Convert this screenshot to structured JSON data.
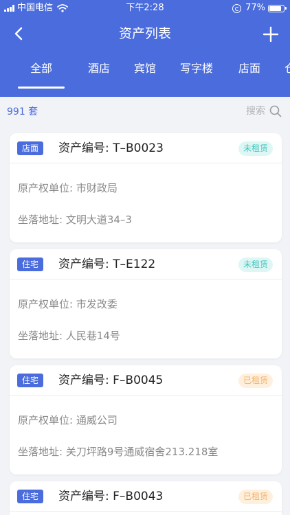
{
  "status_bar": {
    "carrier": "中国电信",
    "time": "下午2:28",
    "battery": "77%"
  },
  "nav": {
    "title": "资产列表"
  },
  "tabs": [
    "全部",
    "酒店",
    "宾馆",
    "写字楼",
    "店面",
    "仓"
  ],
  "active_tab_index": 0,
  "summary": {
    "count": "991 套",
    "search_label": "搜索"
  },
  "assets": [
    {
      "type": "店面",
      "code": "资产编号: T–B0023",
      "status": "未租赁",
      "owner": "原产权单位: 市财政局",
      "address": "坐落地址: 文明大道34–3"
    },
    {
      "type": "住宅",
      "code": "资产编号: T–E122",
      "status": "未租赁",
      "owner": "原产权单位: 市发改委",
      "address": "坐落地址: 人民巷14号"
    },
    {
      "type": "住宅",
      "code": "资产编号: F–B0045",
      "status": "已租赁",
      "owner": "原产权单位: 通威公司",
      "address": "坐落地址: 关刀坪路9号通威宿舍213.218室"
    },
    {
      "type": "住宅",
      "code": "资产编号: F–B0043",
      "status": "已租赁",
      "owner": "",
      "address": ""
    }
  ],
  "colors": {
    "primary": "#4a6cdd",
    "status_free_text": "#46c4bd",
    "status_free_bg": "#def7f5",
    "status_rented_text": "#f0b46c",
    "status_rented_bg": "#fff0de"
  },
  "icons": {
    "back": "chevron-left-icon",
    "add": "plus-icon",
    "search": "magnifier-icon",
    "wifi": "wifi-icon",
    "battery": "battery-icon",
    "orientation_lock": "orientation-lock-icon"
  }
}
